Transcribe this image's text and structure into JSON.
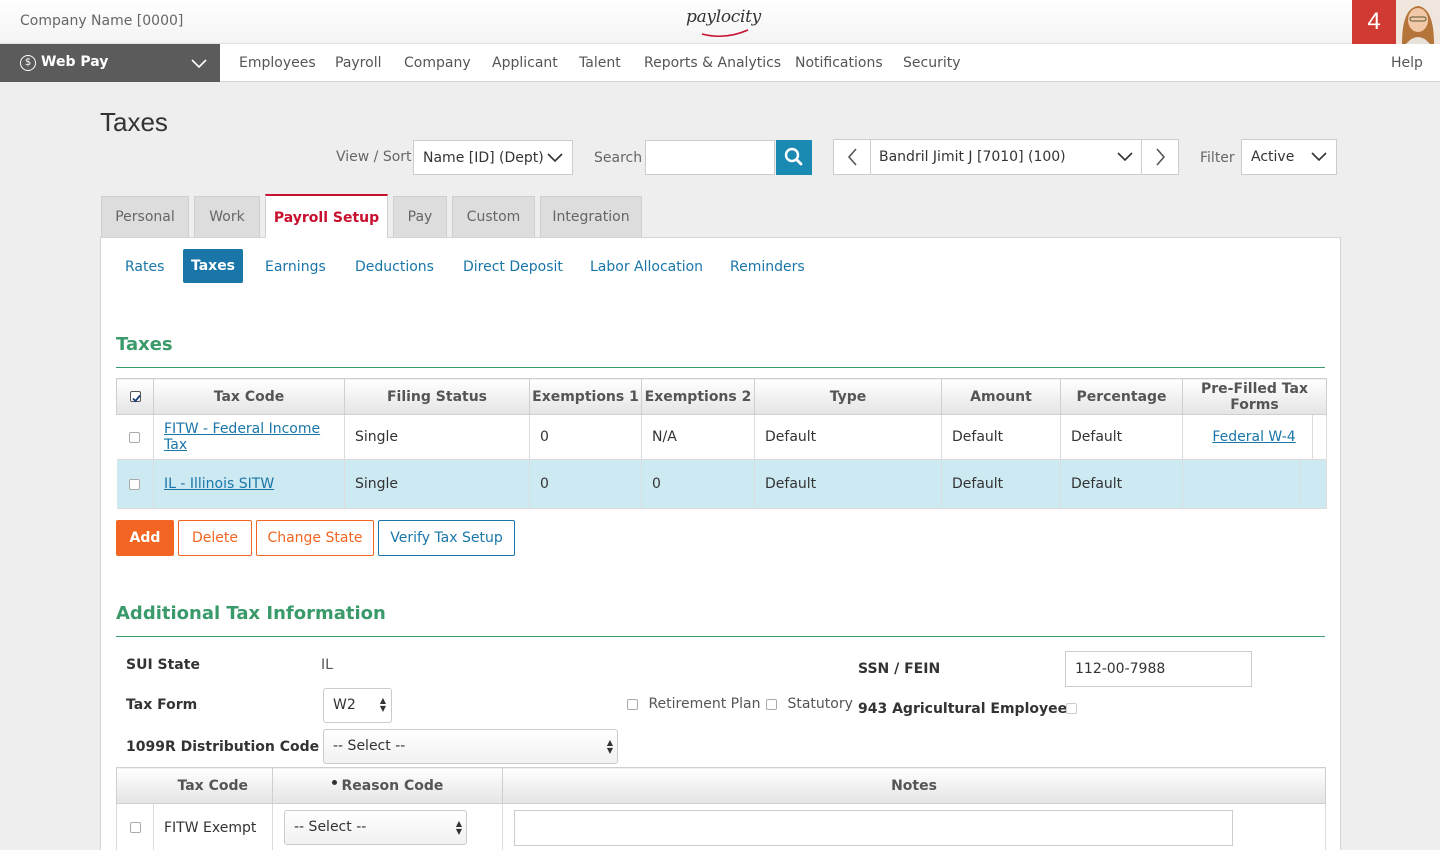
{
  "header": {
    "company": "Company Name [0000]",
    "logo_text": "paylocity",
    "notification_count": "4"
  },
  "nav": {
    "module": "Web Pay",
    "items": [
      "Employees",
      "Payroll",
      "Company",
      "Applicant",
      "Talent",
      "Reports & Analytics",
      "Notifications",
      "Security"
    ],
    "help": "Help"
  },
  "page": {
    "title": "Taxes",
    "view_sort_label": "View / Sort",
    "view_sort_value": "Name [ID] (Dept)",
    "search_label": "Search",
    "search_value": "",
    "employee": "Bandril Jimit J [7010] (100)",
    "filter_label": "Filter",
    "filter_value": "Active"
  },
  "tabs": [
    "Personal",
    "Work",
    "Payroll Setup",
    "Pay",
    "Custom",
    "Integration"
  ],
  "active_tab": "Payroll Setup",
  "subtabs": [
    "Rates",
    "Taxes",
    "Earnings",
    "Deductions",
    "Direct Deposit",
    "Labor Allocation",
    "Reminders"
  ],
  "active_subtab": "Taxes",
  "taxes": {
    "heading": "Taxes",
    "columns": [
      "Tax Code",
      "Filing Status",
      "Exemptions 1",
      "Exemptions 2",
      "Type",
      "Amount",
      "Percentage",
      "Pre-Filled Tax Forms"
    ],
    "rows": [
      {
        "tax_code": "FITW - Federal Income Tax",
        "filing_status": "Single",
        "exemptions1": "0",
        "exemptions2": "N/A",
        "type": "Default",
        "amount": "Default",
        "percentage": "Default",
        "form": "Federal W-4"
      },
      {
        "tax_code": "IL - Illinois SITW",
        "filing_status": "Single",
        "exemptions1": "0",
        "exemptions2": "0",
        "type": "Default",
        "amount": "Default",
        "percentage": "Default",
        "form": ""
      }
    ]
  },
  "buttons": {
    "add": "Add",
    "delete": "Delete",
    "change_state": "Change State",
    "verify": "Verify Tax Setup"
  },
  "additional": {
    "heading": "Additional Tax Information",
    "sui_state_label": "SUI State",
    "sui_state_value": "IL",
    "ssn_label": "SSN / FEIN",
    "ssn_value": "112-00-7988",
    "tax_form_label": "Tax Form",
    "tax_form_value": "W2",
    "retirement_plan": "Retirement Plan",
    "statutory": "Statutory",
    "ag_employee": "943 Agricultural Employee",
    "dist_code_label": "1099R Distribution Code",
    "dist_code_value": "-- Select --"
  },
  "exempt_table": {
    "columns": [
      "Tax Code",
      "Reason Code",
      "Notes"
    ],
    "row": {
      "tax_code": "FITW Exempt",
      "reason": "-- Select --",
      "notes": ""
    }
  },
  "colors": {
    "accent_red": "#c8102e",
    "orange": "#f26522",
    "blue": "#1a76a8",
    "green": "#3a9a6a",
    "selected_row": "#cde9f2"
  }
}
